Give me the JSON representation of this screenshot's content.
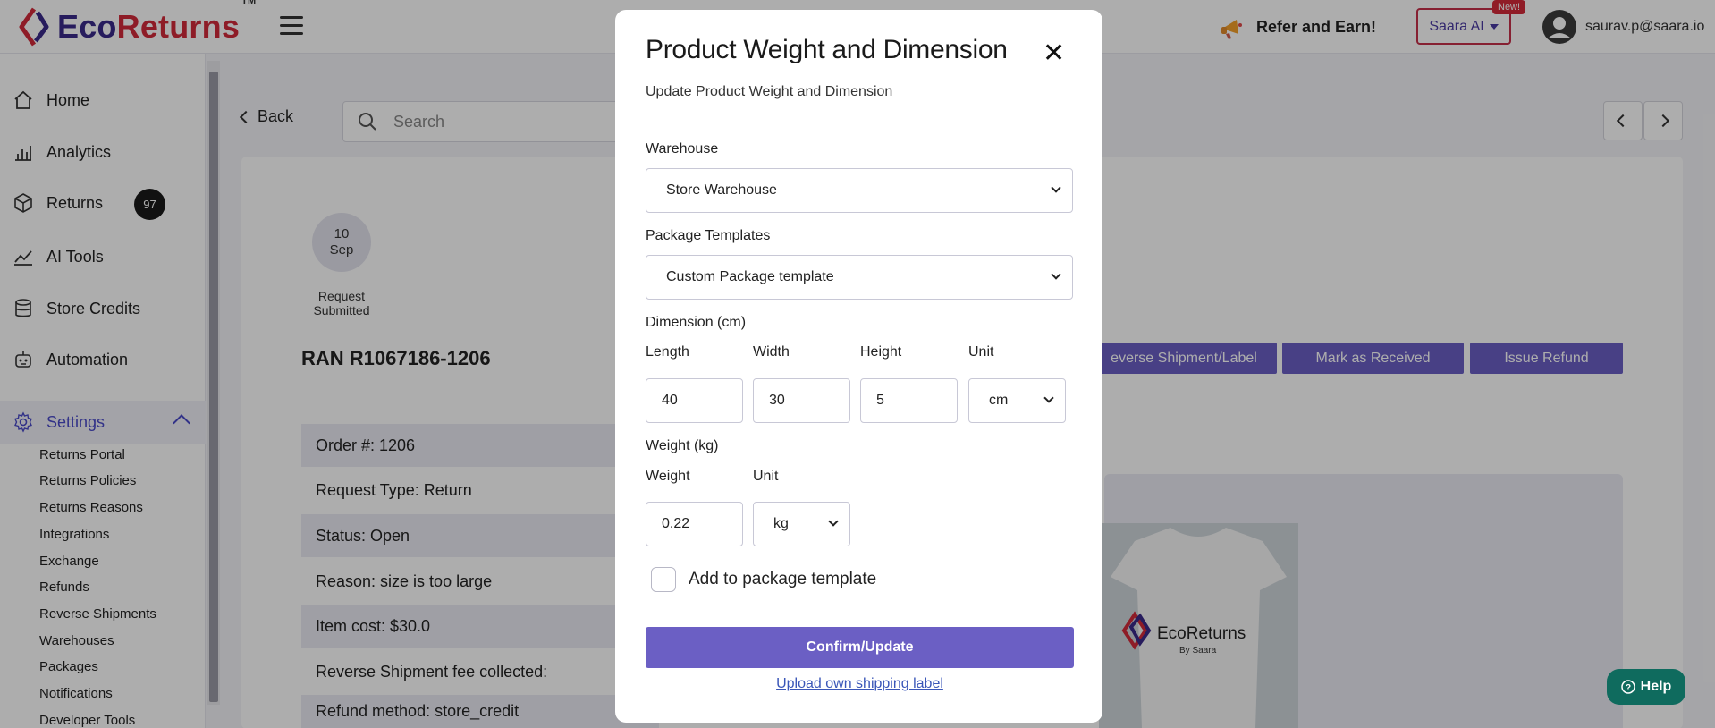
{
  "header": {
    "logo_part1": "Eco",
    "logo_part2": "Returns",
    "logo_tm": "TM",
    "refer_label": "Refer and Earn!",
    "saara_label": "Saara AI",
    "new_badge": "New!",
    "user_email": "saurav.p@saara.io"
  },
  "sidebar": {
    "items": [
      {
        "label": "Home",
        "icon": "home-icon"
      },
      {
        "label": "Analytics",
        "icon": "analytics-icon"
      },
      {
        "label": "Returns",
        "icon": "box-icon",
        "badge": "97"
      },
      {
        "label": "AI Tools",
        "icon": "trend-icon"
      },
      {
        "label": "Store Credits",
        "icon": "database-icon"
      },
      {
        "label": "Automation",
        "icon": "robot-icon"
      }
    ],
    "settings_label": "Settings",
    "settings_sub": [
      "Returns Portal",
      "Returns Policies",
      "Returns Reasons",
      "Integrations",
      "Exchange",
      "Refunds",
      "Reverse Shipments",
      "Warehouses",
      "Packages",
      "Notifications",
      "Developer Tools"
    ]
  },
  "main": {
    "back_label": "Back",
    "search_placeholder": "Search",
    "date_day": "10",
    "date_month": "Sep",
    "step_label": "Request Submitted",
    "ran": "RAN R1067186-1206",
    "actions": [
      "everse Shipment/Label",
      "Mark as Received",
      "Issue Refund"
    ],
    "details": [
      "Order #: 1206",
      "Request Type: Return",
      "Status: Open",
      "Reason: size is too large",
      "Item cost: $30.0",
      "Reverse Shipment fee collected:",
      "Refund method: store_credit"
    ],
    "product_brand": "EcoReturns",
    "product_by": "By Saara",
    "help_label": "Help"
  },
  "modal": {
    "title": "Product Weight and Dimension",
    "subtitle": "Update Product Weight and Dimension",
    "warehouse_label": "Warehouse",
    "warehouse_value": "Store Warehouse",
    "package_label": "Package Templates",
    "package_value": "Custom Package template",
    "dimension_label": "Dimension (cm)",
    "length_label": "Length",
    "width_label": "Width",
    "height_label": "Height",
    "unit_label": "Unit",
    "length_value": "40",
    "width_value": "30",
    "height_value": "5",
    "dim_unit_value": "cm",
    "weight_section_label": "Weight (kg)",
    "weight_label": "Weight",
    "weight_unit_label": "Unit",
    "weight_value": "0.22",
    "weight_unit_value": "kg",
    "checkbox_label": "Add to package template",
    "confirm_label": "Confirm/Update",
    "upload_label": "Upload own shipping label"
  },
  "colors": {
    "accent": "#6b5fc4",
    "brand_dark": "#3a2a8a",
    "brand_red": "#d12a3a",
    "help_green": "#0f6b5e"
  }
}
